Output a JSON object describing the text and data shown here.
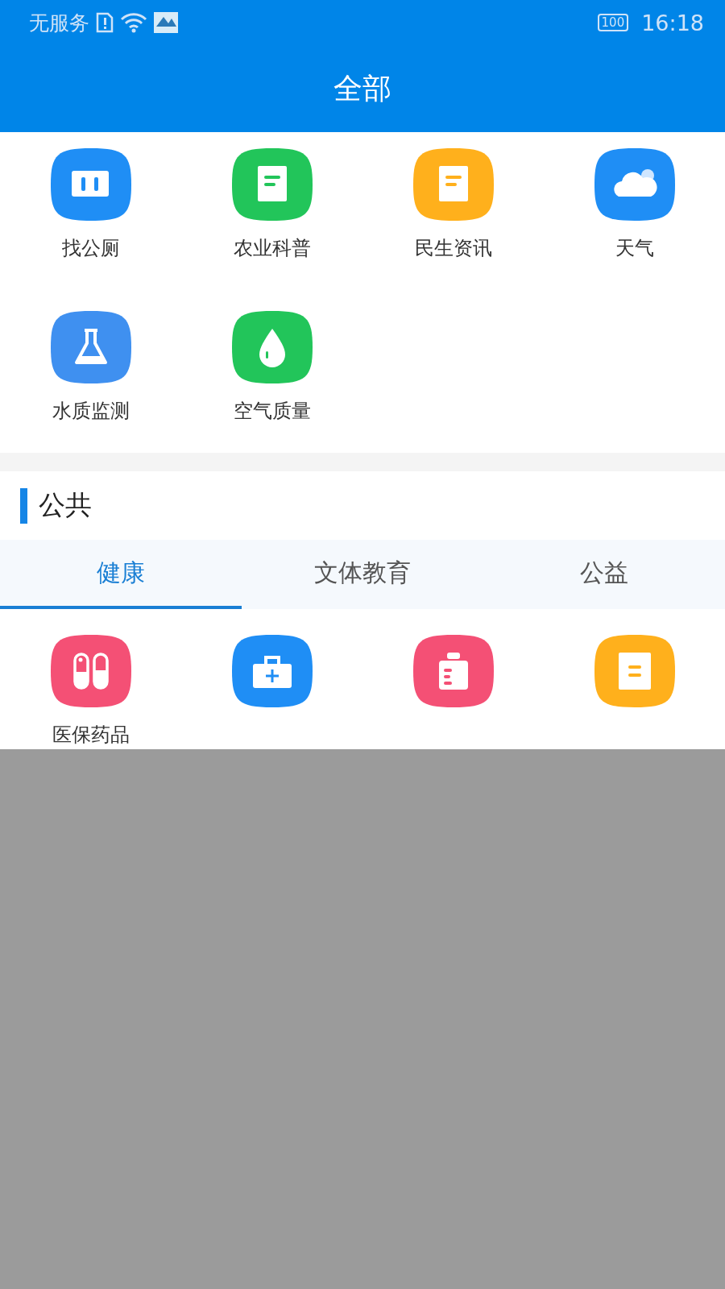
{
  "status_bar": {
    "carrier": "无服务",
    "battery": "100",
    "time": "16:18"
  },
  "header": {
    "title": "全部"
  },
  "all_services": [
    {
      "label": "找公厕",
      "kind": "toilet",
      "color": "#1f8ef5"
    },
    {
      "label": "农业科普",
      "kind": "doc",
      "color": "#22c55a"
    },
    {
      "label": "民生资讯",
      "kind": "doc",
      "color": "#ffb01c"
    },
    {
      "label": "天气",
      "kind": "cloud",
      "color": "#1f8ef5"
    },
    {
      "label": "水质监测",
      "kind": "flask",
      "color": "#3f90f0"
    },
    {
      "label": "空气质量",
      "kind": "drop",
      "color": "#22c55a"
    }
  ],
  "section": {
    "title": "公共"
  },
  "tabs": [
    {
      "label": "健康",
      "selected": true
    },
    {
      "label": "文体教育",
      "selected": false
    },
    {
      "label": "公益",
      "selected": false
    }
  ],
  "health_services": [
    {
      "label": "医保药品",
      "kind": "pills",
      "color": "#f45075"
    },
    {
      "kind": "kit",
      "color": "#1f8ef5"
    },
    {
      "kind": "jar",
      "color": "#f45075"
    },
    {
      "kind": "memo",
      "color": "#ffb01c"
    }
  ]
}
